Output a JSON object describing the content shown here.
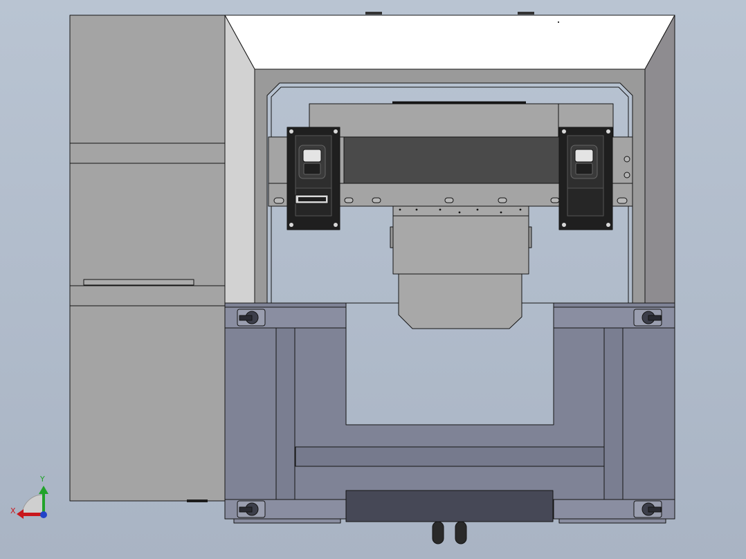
{
  "view": {
    "background_top": "#b9c4d2",
    "background_bottom": "#a9b4c4"
  },
  "triad": {
    "x_label": "X",
    "y_label": "Y",
    "x_color": "#c8171d",
    "y_color": "#21a32a",
    "z_color": "#2244c8"
  },
  "palette": {
    "edge": "#141414",
    "cabinet": "#a4a4a4",
    "hood_light": "#ffffff",
    "hood_side_left": "#d2d2d2",
    "hood_side_right": "#8e8c90",
    "inner_frame": "#9a9a9a",
    "base_frame": "#7f8396",
    "mount_plate": "#1f1f1f",
    "dark_block": "#4a4a4a",
    "base_block": "#464856"
  }
}
